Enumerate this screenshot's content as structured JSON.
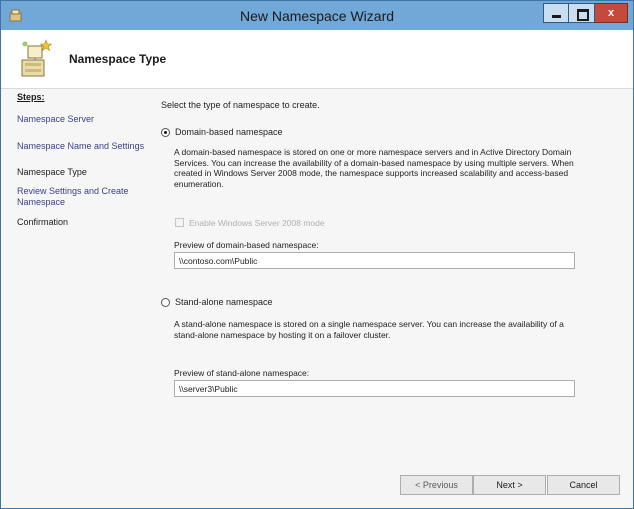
{
  "window": {
    "title": "New Namespace Wizard",
    "close_glyph": "x"
  },
  "header": {
    "title": "Namespace Type",
    "icon": "namespace-wizard-icon"
  },
  "sidebar": {
    "steps_label": "Steps:",
    "items": [
      {
        "label": "Namespace Server",
        "state": "link"
      },
      {
        "label": "Namespace Name and Settings",
        "state": "link"
      },
      {
        "label": "Namespace Type",
        "state": "current"
      },
      {
        "label": "Review Settings and Create Namespace",
        "state": "link"
      },
      {
        "label": "Confirmation",
        "state": "disabled"
      }
    ]
  },
  "main": {
    "instruction": "Select the type of namespace to create.",
    "domain_option": {
      "label": "Domain-based namespace",
      "selected": true,
      "description": "A domain-based namespace is stored on one or more namespace servers and in Active Directory Domain Services. You can increase the availability of a domain-based namespace by using multiple servers. When created in Windows Server 2008 mode, the namespace supports increased scalability and access-based enumeration.",
      "checkbox_label": "Enable Windows Server 2008 mode",
      "checkbox_checked": false,
      "checkbox_enabled": false,
      "preview_label": "Preview of domain-based namespace:",
      "preview_value": "\\\\contoso.com\\Public"
    },
    "standalone_option": {
      "label": "Stand-alone namespace",
      "selected": false,
      "description": "A stand-alone namespace is stored on a single namespace server. You can increase the availability of a stand-alone namespace by hosting it on a failover cluster.",
      "preview_label": "Preview of stand-alone namespace:",
      "preview_value": "\\\\server3\\Public"
    }
  },
  "footer": {
    "previous_label": "< Previous",
    "next_label": "Next >",
    "cancel_label": "Cancel"
  },
  "colors": {
    "titlebar": "#71a8d8",
    "link": "#3b3e8f",
    "close_button": "#c44a3b"
  }
}
